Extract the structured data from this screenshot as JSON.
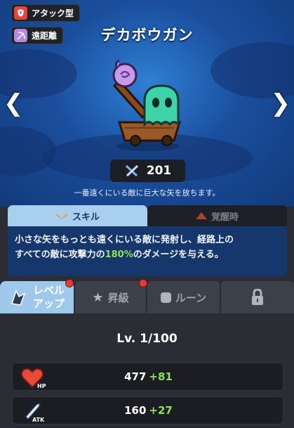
{
  "character": {
    "name": "デカボウガン",
    "power": "201",
    "description": "一番遠くにいる敵に巨大な矢を放ちます。"
  },
  "tags": [
    {
      "label": "アタック型",
      "icon": "attack-type-icon",
      "color": "#e8463c"
    },
    {
      "label": "遠距離",
      "icon": "bow-icon",
      "color": "#b48ae0"
    }
  ],
  "skill_tabs": {
    "skill_label": "スキル",
    "awaken_label": "覚醒時"
  },
  "skill": {
    "text_line1": "小さな矢をもっとも遠くにいる敵に発射し、経路上の",
    "text_line2_pre": "すべての敵に攻撃力の",
    "text_highlight": "180%",
    "text_line2_post": "のダメージを与える。"
  },
  "bottom_tabs": {
    "levelup_line1": "レベル",
    "levelup_line2": "アップ",
    "promote_label": "昇級",
    "rune_label": "ルーン"
  },
  "level": {
    "label": "Lv. 1/100"
  },
  "stats": {
    "hp": {
      "value": "477",
      "bonus": "+81",
      "icon_label": "HP"
    },
    "atk": {
      "value": "160",
      "bonus": "+27",
      "icon_label": "ATK"
    }
  },
  "colors": {
    "highlight": "#8ee35a",
    "hero_bg": "#1b4f9e",
    "notification": "#e53a3a"
  }
}
